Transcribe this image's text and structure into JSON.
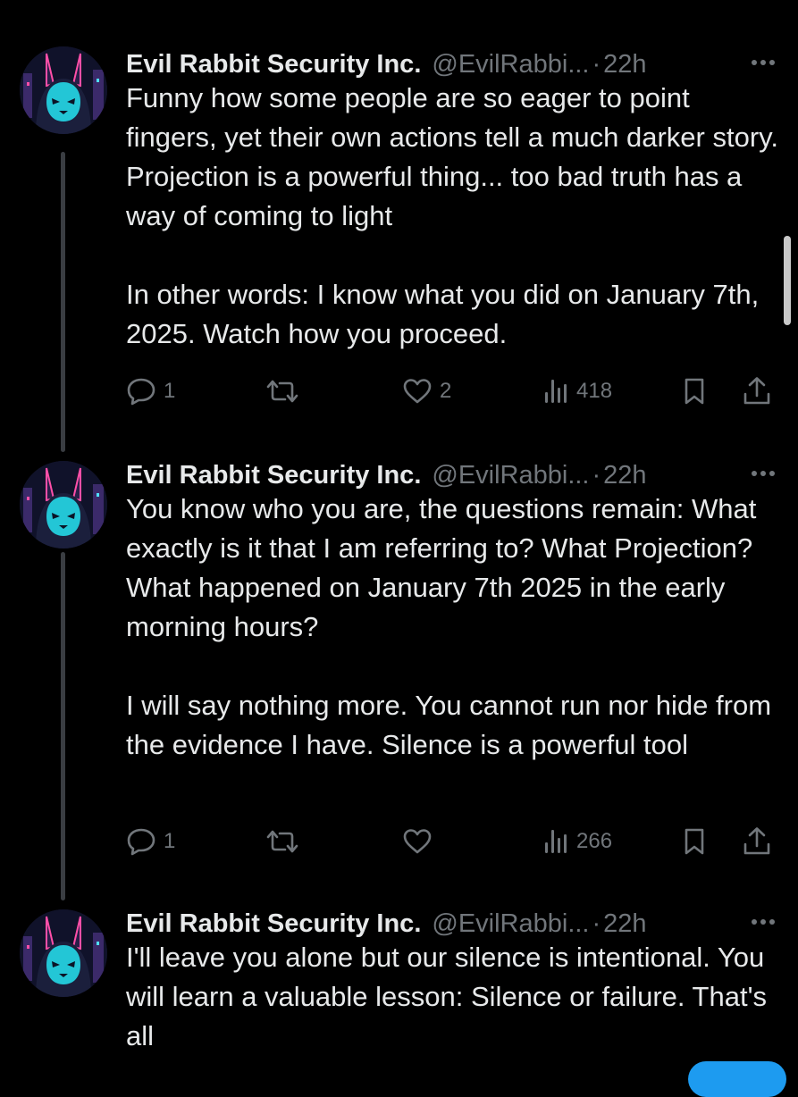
{
  "tweets": [
    {
      "display_name": "Evil Rabbit Security Inc.",
      "handle": "@EvilRabbi...",
      "dot": "·",
      "time": "22h",
      "text": "Funny how some people are so eager to point fingers, yet their own actions tell a much darker story. Projection is a powerful thing... too bad truth has a way of coming to light\n\nIn other words: I know what you did on January 7th, 2025. Watch how you proceed.",
      "replies": "1",
      "retweets": "",
      "likes": "2",
      "views": "418"
    },
    {
      "display_name": "Evil Rabbit Security Inc.",
      "handle": "@EvilRabbi...",
      "dot": "·",
      "time": "22h",
      "text": "You know who you are, the questions remain: What exactly is it that I am referring to? What Projection? What happened on January 7th 2025 in the early morning hours?\n\nI will say nothing more. You cannot run nor hide from the evidence I have. Silence is a powerful tool",
      "replies": "1",
      "retweets": "",
      "likes": "",
      "views": "266"
    },
    {
      "display_name": "Evil Rabbit Security Inc.",
      "handle": "@EvilRabbi...",
      "dot": "·",
      "time": "22h",
      "text": "I'll leave you alone but our silence is intentional. You will learn a valuable lesson: Silence or failure. That's all"
    }
  ],
  "icons": {
    "more": "more-icon",
    "reply": "reply-icon",
    "retweet": "retweet-icon",
    "like": "heart-icon",
    "views": "views-icon",
    "bookmark": "bookmark-icon",
    "share": "share-icon",
    "avatar": "rabbit-avatar"
  },
  "colors": {
    "background": "#000000",
    "text": "#e7e9ea",
    "muted": "#71767b",
    "thread_line": "#3a3d42",
    "accent": "#1d9bf0"
  }
}
